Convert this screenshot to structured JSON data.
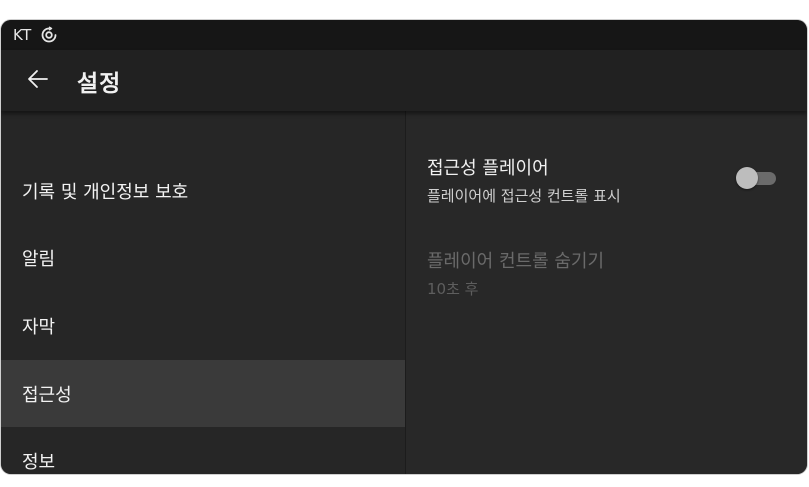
{
  "status_bar": {
    "carrier": "KT",
    "status_icon": "circular-sync-icon"
  },
  "app_bar": {
    "back_icon": "arrow-left-icon",
    "title": "설정"
  },
  "menu": {
    "items": [
      {
        "label": "기록 및 개인정보 보호",
        "selected": false
      },
      {
        "label": "알림",
        "selected": false
      },
      {
        "label": "자막",
        "selected": false
      },
      {
        "label": "접근성",
        "selected": true
      },
      {
        "label": "정보",
        "selected": false
      }
    ]
  },
  "settings": {
    "accessibility_player": {
      "title": "접근성 플레이어",
      "subtitle": "플레이어에 접근성 컨트롤 표시",
      "enabled": false
    },
    "hide_player_controls": {
      "title": "플레이어 컨트롤 숨기기",
      "subtitle": "10초 후",
      "disabled": true
    }
  },
  "colors": {
    "background": "#282828",
    "app_bar": "#212121",
    "selected_item": "#3a3a3a",
    "toggle_off_track": "#6b6b6b",
    "toggle_off_thumb": "#bdbdbd"
  }
}
